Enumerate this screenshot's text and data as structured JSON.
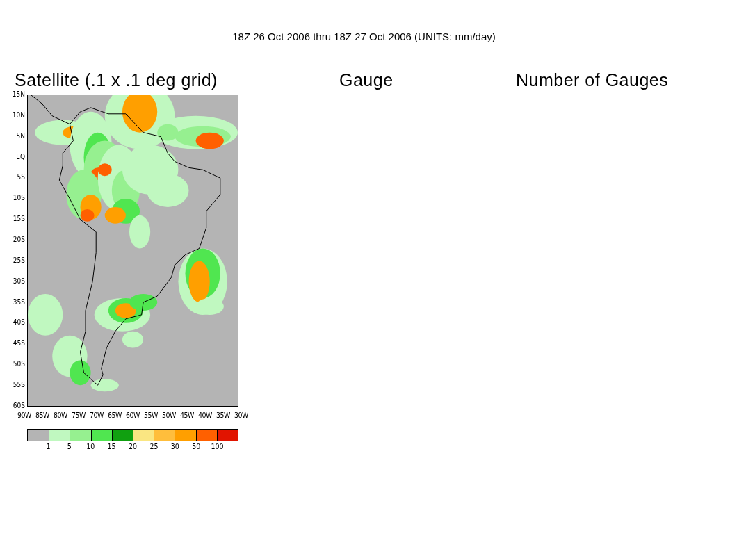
{
  "title": "18Z 26 Oct 2006 thru 18Z 27 Oct 2006 (UNITS: mm/day)",
  "panels": [
    {
      "kind": "map",
      "title": "Satellite (.1 x .1 deg grid)",
      "y_labels": [
        "15N",
        "10N",
        "5N",
        "EQ",
        "5S",
        "10S",
        "15S",
        "20S",
        "25S",
        "30S",
        "35S",
        "40S",
        "45S",
        "50S",
        "55S",
        "60S"
      ],
      "x_labels": [
        "90W",
        "85W",
        "80W",
        "75W",
        "70W",
        "65W",
        "60W",
        "55W",
        "50W",
        "45W",
        "40W",
        "35W",
        "30W"
      ]
    },
    {
      "kind": "empty",
      "title": "Gauge"
    },
    {
      "kind": "empty",
      "title": "Number of Gauges"
    }
  ],
  "legend": {
    "swatches": [
      {
        "color": "#b4b4b4"
      },
      {
        "color": "#c0f8c0"
      },
      {
        "color": "#96f090"
      },
      {
        "color": "#50e650"
      },
      {
        "color": "#10a010"
      },
      {
        "color": "#fae682"
      },
      {
        "color": "#ffbe3c"
      },
      {
        "color": "#ff9f00"
      },
      {
        "color": "#ff6000"
      },
      {
        "color": "#e11400"
      }
    ],
    "labels": [
      "1",
      "5",
      "10",
      "15",
      "20",
      "25",
      "30",
      "50",
      "100"
    ]
  }
}
